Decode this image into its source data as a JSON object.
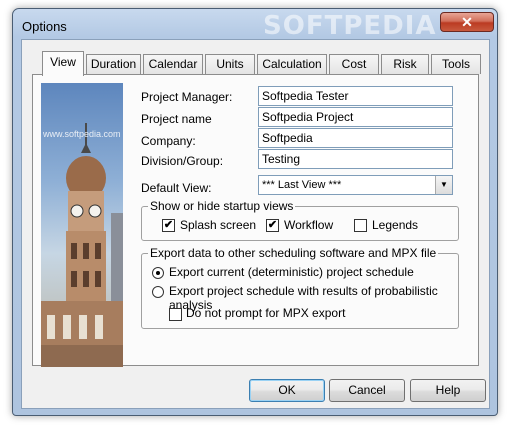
{
  "window": {
    "title": "Options",
    "watermark": "SOFTPEDIA",
    "close_glyph": "✕"
  },
  "tabs": [
    {
      "label": "View",
      "active": true
    },
    {
      "label": "Duration"
    },
    {
      "label": "Calendar"
    },
    {
      "label": "Units"
    },
    {
      "label": "Calculation"
    },
    {
      "label": "Cost"
    },
    {
      "label": "Risk"
    },
    {
      "label": "Tools"
    }
  ],
  "photo": {
    "watermark": "www.softpedia.com"
  },
  "fields": {
    "project_manager": {
      "label": "Project Manager:",
      "value": "Softpedia Tester"
    },
    "project_name": {
      "label": "Project name",
      "value": "Softpedia Project"
    },
    "company": {
      "label": "Company:",
      "value": "Softpedia"
    },
    "division": {
      "label": "Division/Group:",
      "value": "Testing"
    },
    "default_view": {
      "label": "Default View:",
      "value": "*** Last View ***",
      "arrow": "▼"
    }
  },
  "startup_group": {
    "legend": "Show or hide startup views",
    "splash": {
      "label": "Splash screen",
      "checked": true
    },
    "workflow": {
      "label": "Workflow",
      "checked": true
    },
    "legends": {
      "label": "Legends",
      "checked": false
    }
  },
  "export_group": {
    "legend": "Export data to other scheduling software and MPX file",
    "option1": {
      "label": "Export current (deterministic) project schedule",
      "selected": true
    },
    "option2": {
      "label": "Export project schedule with results of probabilistic analysis",
      "selected": false
    },
    "no_prompt": {
      "label": "Do not prompt for MPX export",
      "checked": false
    }
  },
  "checkmark": "✔",
  "buttons": {
    "ok": "OK",
    "cancel": "Cancel",
    "help": "Help"
  }
}
